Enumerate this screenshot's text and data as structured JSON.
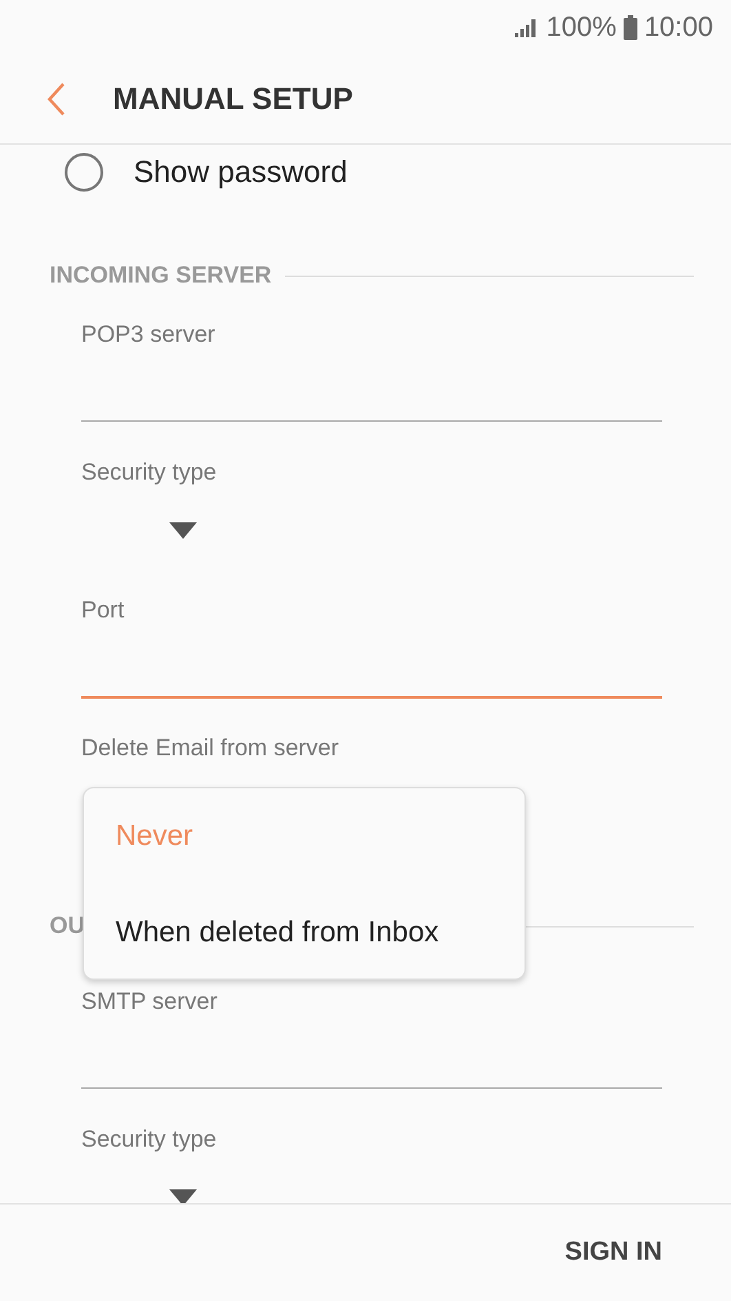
{
  "status_bar": {
    "battery": "100%",
    "time": "10:00"
  },
  "header": {
    "title": "MANUAL SETUP"
  },
  "show_password": {
    "label": "Show password",
    "checked": false
  },
  "sections": [
    {
      "title": "INCOMING SERVER",
      "fields": [
        {
          "kind": "text",
          "label": "POP3 server",
          "focused": false
        },
        {
          "kind": "select",
          "label": "Security type"
        },
        {
          "kind": "text",
          "label": "Port",
          "focused": true
        },
        {
          "kind": "open-select",
          "label": "Delete Email from server",
          "options": [
            {
              "label": "Never",
              "selected": true
            },
            {
              "label": "When deleted from Inbox",
              "selected": false
            }
          ]
        }
      ]
    },
    {
      "title": "OU",
      "fields": [
        {
          "kind": "text",
          "label": "SMTP server",
          "focused": false
        },
        {
          "kind": "select",
          "label": "Security type"
        }
      ]
    }
  ],
  "bottom_bar": {
    "button": "SIGN IN"
  }
}
